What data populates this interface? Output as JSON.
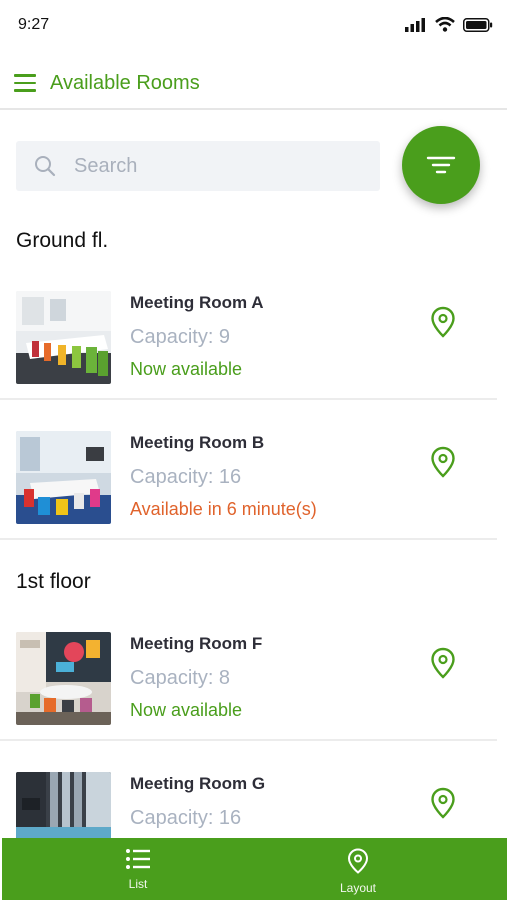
{
  "status_bar": {
    "time": "9:27"
  },
  "header": {
    "title": "Available Rooms",
    "menu_icon": "hamburger-icon"
  },
  "search": {
    "placeholder": "Search",
    "value": ""
  },
  "filter_button": {
    "icon": "filter-icon"
  },
  "sections": [
    {
      "title": "Ground fl.",
      "rooms": [
        {
          "name": "Meeting Room A",
          "capacity": "Capacity: 9",
          "status": "Now available",
          "status_color": "#4a9e1c"
        },
        {
          "name": "Meeting Room B",
          "capacity": "Capacity: 16",
          "status": "Available in 6 minute(s)",
          "status_color": "#e0632c"
        }
      ]
    },
    {
      "title": "1st floor",
      "rooms": [
        {
          "name": "Meeting Room F",
          "capacity": "Capacity: 8",
          "status": "Now available",
          "status_color": "#4a9e1c"
        },
        {
          "name": "Meeting Room G",
          "capacity": "Capacity: 16",
          "status": "",
          "status_color": "#4a9e1c"
        }
      ]
    }
  ],
  "bottom_nav": {
    "items": [
      {
        "label": "List",
        "icon": "list-icon"
      },
      {
        "label": "Layout",
        "icon": "location-pin-icon"
      }
    ]
  },
  "colors": {
    "accent": "#4a9e1c",
    "warning": "#e0632c",
    "muted": "#a9b2c0"
  }
}
